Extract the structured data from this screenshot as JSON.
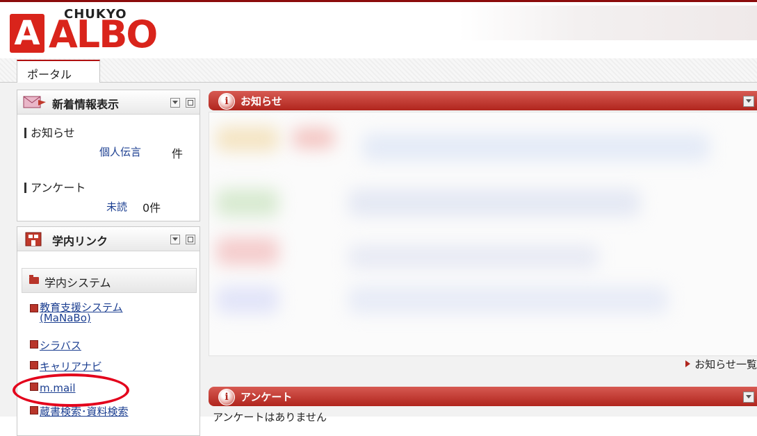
{
  "logo": {
    "letter": "A",
    "brand_top": "CHUKYO",
    "brand_main": "ALBO"
  },
  "tabs": [
    {
      "label": "ポータル"
    }
  ],
  "new_info_panel": {
    "title": "新着情報表示",
    "notices_label": "お知らせ",
    "personal_msg_link": "個人伝言",
    "personal_count_unit": "件",
    "survey_label": "アンケート",
    "unread_link": "未読",
    "unread_count": "0件"
  },
  "campus_links_panel": {
    "title": "学内リンク",
    "section_title": "学内システム",
    "items": [
      {
        "label": "教育支援システム\n(MaNaBo)"
      },
      {
        "label": "シラバス"
      },
      {
        "label": "キャリアナビ"
      },
      {
        "label": "m.mail"
      },
      {
        "label": "蔵書検索･資料検索"
      }
    ]
  },
  "notices_bar": {
    "title": "お知らせ"
  },
  "notices_more": "お知らせ一覧",
  "survey_bar": {
    "title": "アンケート"
  },
  "survey_empty": "アンケートはありません",
  "colors": {
    "accent": "#b0251d",
    "logo_red": "#d9241b",
    "highlight_oval": "#e3001b",
    "link": "#1c3f91"
  }
}
